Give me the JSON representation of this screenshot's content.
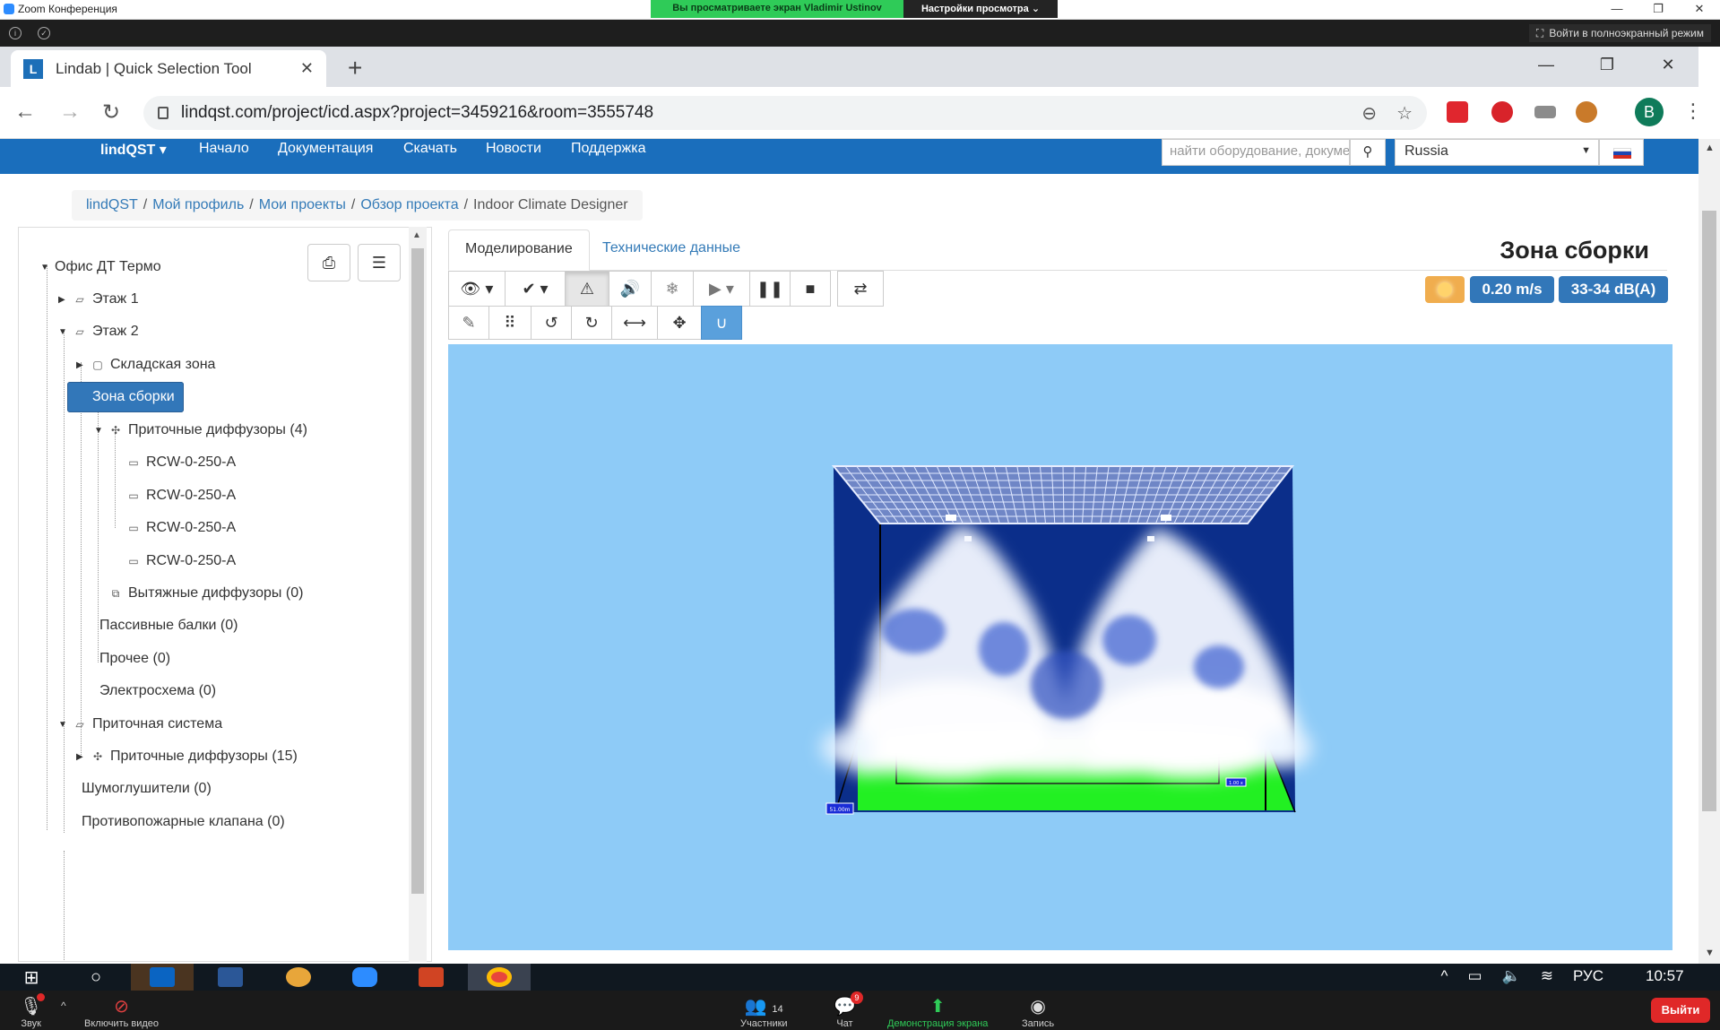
{
  "zoom": {
    "app_title": "Zoom Конференция",
    "share_notice": "Вы просматриваете экран Vladimir Ustinov",
    "view_options": "Настройки просмотра ⌄",
    "fullscreen_label": "Войти в полноэкранный режим",
    "controls": {
      "audio": "Звук",
      "video": "Включить видео",
      "participants": "Участники",
      "participants_count": "14",
      "chat": "Чат",
      "chat_badge": "9",
      "share": "Демонстрация экрана",
      "record": "Запись",
      "leave": "Выйти"
    }
  },
  "browser": {
    "tab_title": "Lindab | Quick Selection Tool",
    "favicon_letter": "L",
    "url": "lindqst.com/project/icd.aspx?project=3459216&room=3555748",
    "profile_letter": "B"
  },
  "site": {
    "brand": "lindQST ▾",
    "nav": [
      "Начало",
      "Документация",
      "Скачать",
      "Новости",
      "Поддержка"
    ],
    "search_placeholder": "найти оборудование, документ",
    "country": "Russia"
  },
  "breadcrumb": {
    "links": [
      "lindQST",
      "Мой профиль",
      "Мои проекты",
      "Обзор проекта"
    ],
    "current": "Indoor Climate Designer"
  },
  "tree": {
    "root": "Офис ДТ Термо",
    "nodes": [
      "Этаж 1",
      "Этаж 2",
      "Складская зона",
      "Зона сборки",
      "Приточные диффузоры (4)",
      "RCW-0-250-A",
      "RCW-0-250-A",
      "RCW-0-250-A",
      "RCW-0-250-A",
      "Вытяжные диффузоры (0)",
      "Пассивные балки (0)",
      "Прочее (0)",
      "Электросхема (0)",
      "Приточная система",
      "Приточные диффузоры (15)",
      "Шумоглушители (0)",
      "Противопожарные клапана (0)"
    ]
  },
  "main": {
    "tabs": [
      "Моделирование",
      "Технические данные"
    ],
    "zone_title": "Зона сборки",
    "velocity": "0.20 m/s",
    "sound_level": "33-34 dB(A)"
  },
  "scene": {
    "label_left": "51.00m",
    "label_right": "1.00 x"
  },
  "system": {
    "time": "10:57",
    "language": "РУС"
  },
  "colors": {
    "brand_blue": "#1a6ebc",
    "selection_blue": "#3277b9",
    "canvas_bg": "#8ecbf7",
    "room_wall": "#0b2e8a",
    "floor_zone": "#22f022"
  }
}
